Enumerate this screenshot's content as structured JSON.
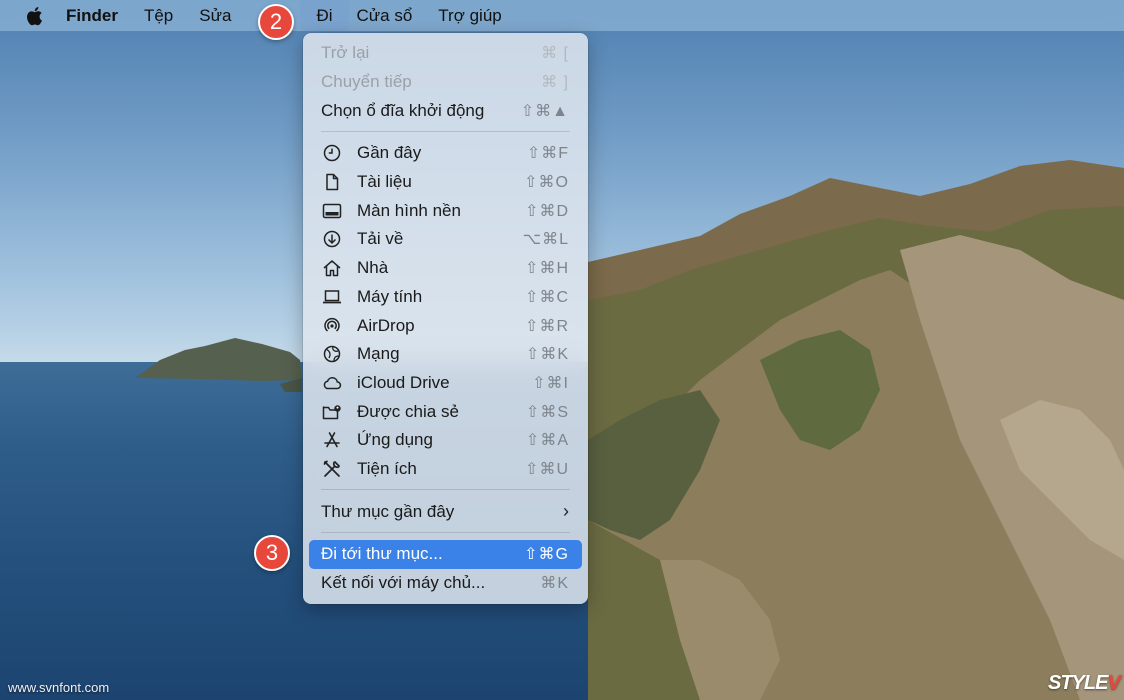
{
  "menubar": {
    "apple_icon": "apple-logo-icon",
    "app_name": "Finder",
    "items": [
      "Tệp",
      "Sửa",
      "Đi",
      "Cửa sổ",
      "Trợ giúp"
    ]
  },
  "badges": {
    "step2": "2",
    "step3": "3",
    "color": "#e8473c"
  },
  "go_menu": {
    "top": [
      {
        "label": "Trở lại",
        "shortcut": "⌘ [",
        "disabled": true
      },
      {
        "label": "Chuyển tiếp",
        "shortcut": "⌘ ]",
        "disabled": true
      },
      {
        "label": "Chọn ổ đĩa khởi động",
        "shortcut": "⇧⌘▲",
        "disabled": false
      }
    ],
    "places": [
      {
        "label": "Gần đây",
        "shortcut": "⇧⌘F",
        "icon": "clock-icon"
      },
      {
        "label": "Tài liệu",
        "shortcut": "⇧⌘O",
        "icon": "document-icon"
      },
      {
        "label": "Màn hình nền",
        "shortcut": "⇧⌘D",
        "icon": "desktop-icon"
      },
      {
        "label": "Tải về",
        "shortcut": "⌥⌘L",
        "icon": "download-icon"
      },
      {
        "label": "Nhà",
        "shortcut": "⇧⌘H",
        "icon": "home-icon"
      },
      {
        "label": "Máy tính",
        "shortcut": "⇧⌘C",
        "icon": "laptop-icon"
      },
      {
        "label": "AirDrop",
        "shortcut": "⇧⌘R",
        "icon": "airdrop-icon"
      },
      {
        "label": "Mạng",
        "shortcut": "⇧⌘K",
        "icon": "globe-icon"
      },
      {
        "label": "iCloud Drive",
        "shortcut": "⇧⌘I",
        "icon": "cloud-icon"
      },
      {
        "label": "Được chia sẻ",
        "shortcut": "⇧⌘S",
        "icon": "shared-folder-icon"
      },
      {
        "label": "Ứng dụng",
        "shortcut": "⇧⌘A",
        "icon": "app-store-icon"
      },
      {
        "label": "Tiện ích",
        "shortcut": "⇧⌘U",
        "icon": "tools-icon"
      }
    ],
    "recent_folders": {
      "label": "Thư mục gần đây",
      "icon": "chevron-right-icon"
    },
    "goto_folder": {
      "label": "Đi tới thư mục...",
      "shortcut": "⇧⌘G",
      "highlighted": true
    },
    "connect_server": {
      "label": "Kết nối với máy chủ...",
      "shortcut": "⌘K"
    }
  },
  "highlight_color": "#3b82e8",
  "watermark": "www.svnfont.com",
  "logo": {
    "text_a": "STYLE",
    "text_b": "V"
  }
}
